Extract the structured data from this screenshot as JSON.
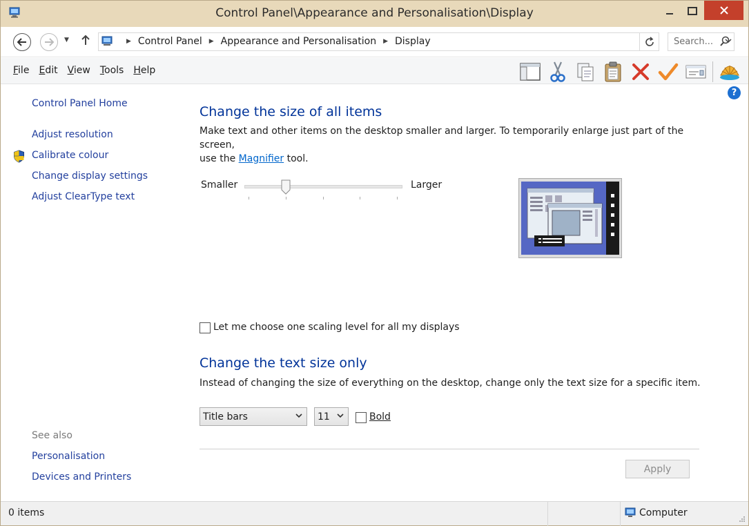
{
  "window": {
    "title": "Control Panel\\Appearance and Personalisation\\Display",
    "accent": "#e8d9ba",
    "close_color": "#c4402b"
  },
  "address": {
    "crumbs": [
      "Control Panel",
      "Appearance and Personalisation",
      "Display"
    ],
    "search_placeholder": "Search..."
  },
  "menu": {
    "items": [
      {
        "label": "File",
        "accel": "F"
      },
      {
        "label": "Edit",
        "accel": "E"
      },
      {
        "label": "View",
        "accel": "V"
      },
      {
        "label": "Tools",
        "accel": "T"
      },
      {
        "label": "Help",
        "accel": "H"
      }
    ],
    "toolbar_icons": [
      "pane-icon",
      "cut-icon",
      "copy-icon",
      "paste-icon",
      "delete-icon",
      "check-icon",
      "properties-icon",
      "shell-icon"
    ]
  },
  "sidebar": {
    "home": "Control Panel Home",
    "links": [
      "Adjust resolution",
      "Calibrate colour",
      "Change display settings",
      "Adjust ClearType text"
    ],
    "see_also_label": "See also",
    "see_also": [
      "Personalisation",
      "Devices and Printers"
    ]
  },
  "main": {
    "section1_title": "Change the size of all items",
    "section1_desc_part1": "Make text and other items on the desktop smaller and larger. To temporarily enlarge just part of the screen,",
    "section1_desc_part2_pre": "use the ",
    "magnifier_link": "Magnifier",
    "section1_desc_part2_post": " tool.",
    "slider_min_label": "Smaller",
    "slider_max_label": "Larger",
    "slider_level": 0.25,
    "scaling_checkbox_label": "Let me choose one scaling level for all my displays",
    "scaling_checked": false,
    "section2_title": "Change the text size only",
    "section2_desc": "Instead of changing the size of everything on the desktop, change only the text size for a specific item.",
    "item_select_value": "Title bars",
    "size_select_value": "11",
    "bold_label": "Bold",
    "bold_checked": false,
    "apply_label": "Apply"
  },
  "status": {
    "items_count": "0 items",
    "location": "Computer"
  }
}
